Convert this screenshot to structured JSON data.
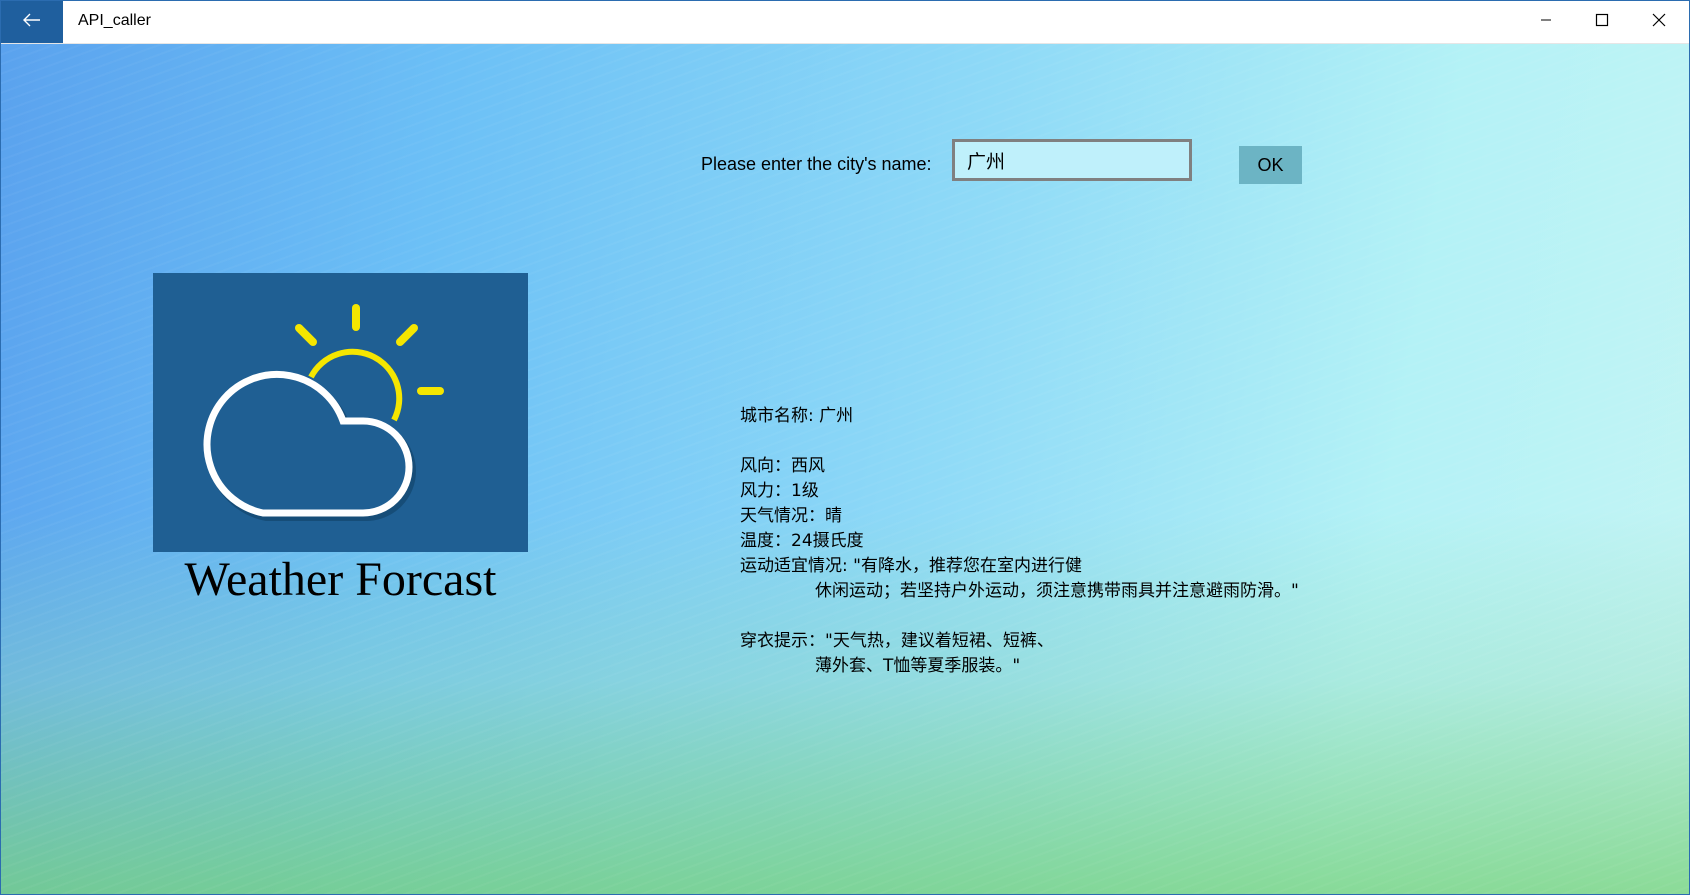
{
  "window": {
    "title": "API_caller",
    "back_icon": "arrow-left-icon",
    "controls": [
      "minimize-icon",
      "maximize-icon",
      "close-icon"
    ]
  },
  "search": {
    "label": "Please enter the city's name:",
    "value": "广州",
    "ok_label": "OK"
  },
  "logo": {
    "caption": "Weather Forcast",
    "icon": "sun-cloud-icon",
    "colors": {
      "background": "#1f5f93",
      "sun": "#f5e600",
      "cloud": "#ffffff"
    }
  },
  "info": {
    "city": "城市名称: 广州",
    "wind_direction": "风向：西风",
    "wind_force": "风力：1级",
    "weather": "天气情况：晴",
    "temperature": "温度：24摄氏度",
    "sport_line1": "运动适宜情况: \"有降水，推荐您在室内进行健",
    "sport_line2": "休闲运动；若坚持户外运动，须注意携带雨具并注意避雨防滑。\"",
    "dress_line1": "穿衣提示：\"天气热，建议着短裙、短裤、",
    "dress_line2": "薄外套、T恤等夏季服装。\""
  }
}
